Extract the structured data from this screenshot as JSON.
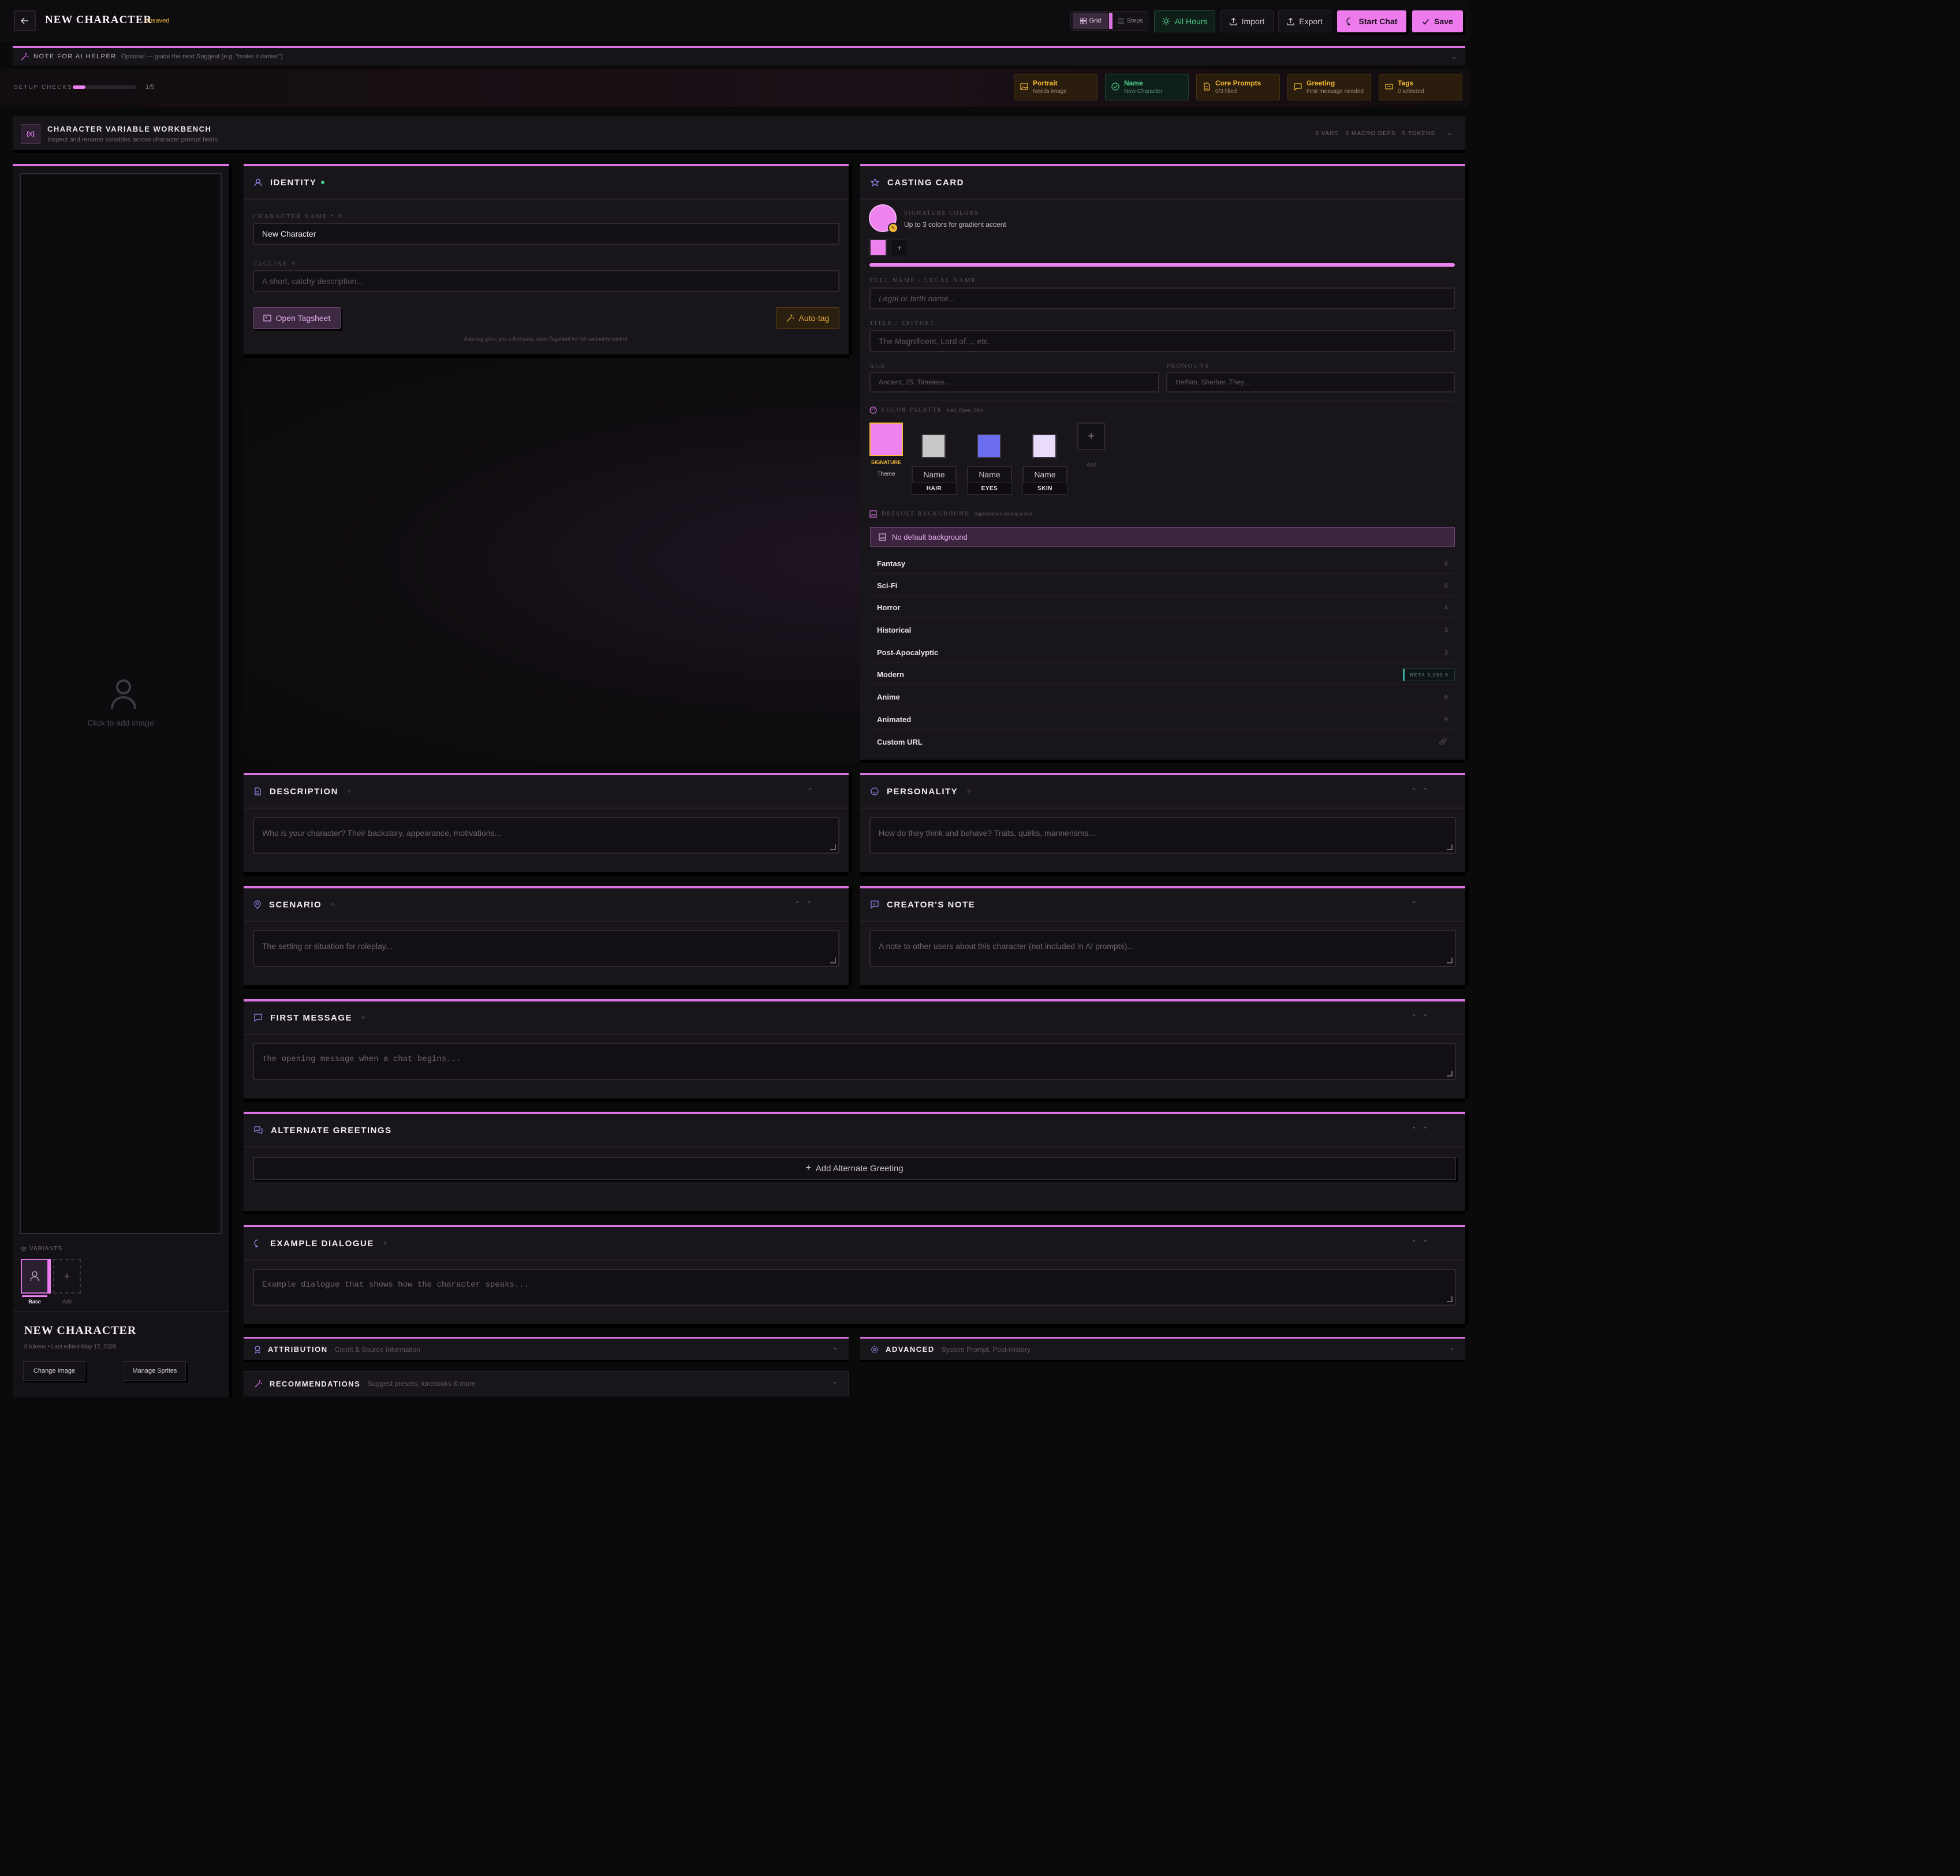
{
  "header": {
    "title": "NEW CHARACTER",
    "status": "Unsaved",
    "view_grid": "Grid",
    "view_steps": "Steps",
    "all_hours": "All Hours",
    "import": "Import",
    "export": "Export",
    "start_chat": "Start Chat",
    "save": "Save"
  },
  "ai_note": {
    "label": "NOTE FOR AI HELPER",
    "placeholder": "Optional — guide the next Suggest (e.g. \"make it darker\")"
  },
  "setup": {
    "label": "SETUP CHECKS",
    "count": "1/5",
    "progress": 0.2,
    "cards": [
      {
        "title": "Portrait",
        "sub": "Needs image"
      },
      {
        "title": "Name",
        "sub": "New Character"
      },
      {
        "title": "Core Prompts",
        "sub": "0/3 filled"
      },
      {
        "title": "Greeting",
        "sub": "First message needed"
      },
      {
        "title": "Tags",
        "sub": "0 selected"
      }
    ]
  },
  "workbench": {
    "title": "CHARACTER VARIABLE WORKBENCH",
    "sub": "Inspect and rename variables across character prompt fields.",
    "stats": "0 VARS   0 MACRO DEFS   0 TOKENS"
  },
  "portrait": {
    "placeholder": "Click to add image",
    "variants_label": "VARIANTS",
    "variant_base": "Base",
    "variant_add": "Add",
    "name": "NEW CHARACTER",
    "meta": "0 tokens • Last edited May 17, 2026",
    "change_image": "Change Image",
    "manage_sprites": "Manage Sprites"
  },
  "identity": {
    "title": "IDENTITY",
    "name_label": "CHARACTER NAME *",
    "name_value": "New Character",
    "tagline_label": "TAGLINE",
    "tagline_placeholder": "A short, catchy description...",
    "open_tagsheet": "Open Tagsheet",
    "auto_tag": "Auto-tag",
    "hint": "Auto-tag gives you a first pass; open Tagsheet for full taxonomy control."
  },
  "casting": {
    "title": "CASTING CARD",
    "sig_label": "SIGNATURE COLORS",
    "sig_sub": "Up to 3 colors for gradient accent",
    "full_name_label": "FULL NAME / LEGAL NAME",
    "full_name_placeholder": "Legal or birth name...",
    "title_label": "TITLE / EPITHET",
    "title_placeholder": "The Magnificent, Lord of..., etc.",
    "age_label": "AGE",
    "age_placeholder": "Ancient, 25, Timeless...",
    "pronouns_label": "PRONOUNS",
    "pronouns_placeholder": "He/him, She/her, They...",
    "palette_label": "COLOR PALETTE",
    "palette_sub": "Hair, Eyes, Skin",
    "signature_tag": "SIGNATURE",
    "theme": "Theme",
    "add": "Add",
    "swatches": [
      {
        "name": "Name",
        "tag": "HAIR",
        "color": "#c8c8c8"
      },
      {
        "name": "Name",
        "tag": "EYES",
        "color": "#6b6cf0"
      },
      {
        "name": "Name",
        "tag": "SKIN",
        "color": "#eadcfb"
      }
    ],
    "bg_label": "DEFAULT BACKGROUND",
    "bg_sub": "Applied when starting a chat",
    "no_bg": "No default background",
    "categories": [
      {
        "name": "Fantasy",
        "count": "8"
      },
      {
        "name": "Sci-Fi",
        "count": "6"
      },
      {
        "name": "Horror",
        "count": "4"
      },
      {
        "name": "Historical",
        "count": "3"
      },
      {
        "name": "Post-Apocalyptic",
        "count": "3"
      },
      {
        "name": "Modern",
        "count": ""
      },
      {
        "name": "Anime",
        "count": "6"
      },
      {
        "name": "Animated",
        "count": "9"
      },
      {
        "name": "Custom URL",
        "count": ""
      }
    ],
    "beta": "BETA 3.099.6"
  },
  "sections": {
    "description": {
      "title": "DESCRIPTION",
      "placeholder": "Who is your character? Their backstory, appearance, motivations..."
    },
    "personality": {
      "title": "PERSONALITY",
      "placeholder": "How do they think and behave? Traits, quirks, mannerisms..."
    },
    "scenario": {
      "title": "SCENARIO",
      "placeholder": "The setting or situation for roleplay..."
    },
    "creators_note": {
      "title": "CREATOR'S NOTE",
      "placeholder": "A note to other users about this character (not included in AI prompts)..."
    },
    "first_message": {
      "title": "FIRST MESSAGE",
      "placeholder": "The opening message when a chat begins..."
    },
    "alt_greetings": {
      "title": "ALTERNATE GREETINGS",
      "add": "Add Alternate Greeting"
    },
    "example_dialogue": {
      "title": "EXAMPLE DIALOGUE",
      "placeholder": "Example dialogue that shows how the character speaks..."
    },
    "attribution": {
      "title": "ATTRIBUTION",
      "sub": "Credit & Source Information"
    },
    "advanced": {
      "title": "ADVANCED",
      "sub": "System Prompt, Post-History"
    },
    "recommendations": {
      "title": "RECOMMENDATIONS",
      "sub": "Suggest presets, lorebooks & more"
    }
  },
  "colors": {
    "accent": "#d873e0",
    "signature": "#ee82ee",
    "amber": "#f2b735",
    "green": "#4ec989"
  }
}
